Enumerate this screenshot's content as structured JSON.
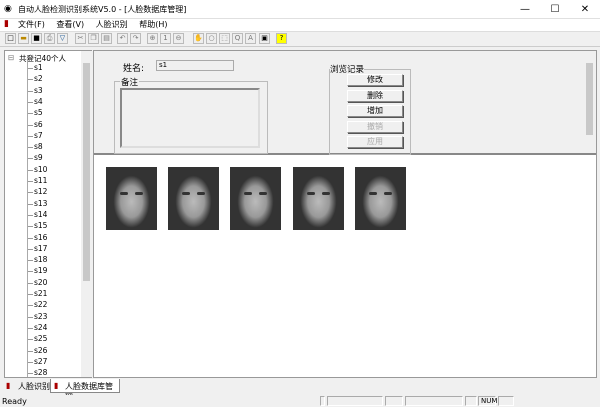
{
  "window": {
    "title": "自动人脸检测识别系统V5.0 - [人脸数据库管理]",
    "min": "—",
    "max": "☐",
    "close": "✕"
  },
  "menu": [
    "文件(F)",
    "查看(V)",
    "人脸识别",
    "帮助(H)"
  ],
  "tree": {
    "root": "共登记40个人",
    "items": [
      "s1",
      "s2",
      "s3",
      "s4",
      "s5",
      "s6",
      "s7",
      "s8",
      "s9",
      "s10",
      "s11",
      "s12",
      "s13",
      "s14",
      "s15",
      "s16",
      "s17",
      "s18",
      "s19",
      "s20",
      "s21",
      "s22",
      "s23",
      "s24",
      "s25",
      "s26",
      "s27",
      "s28"
    ]
  },
  "form": {
    "name_label": "姓名:",
    "name_value": "s1",
    "notes_label": "备注",
    "browse_label": "浏览记录",
    "buttons": {
      "modify": "修改",
      "delete": "删除",
      "add": "增加",
      "undo": "撤销",
      "apply": "应用"
    }
  },
  "tabs": [
    "人脸识别",
    "人脸数据库管理"
  ],
  "status": {
    "text": "Ready",
    "num": "NUM"
  }
}
